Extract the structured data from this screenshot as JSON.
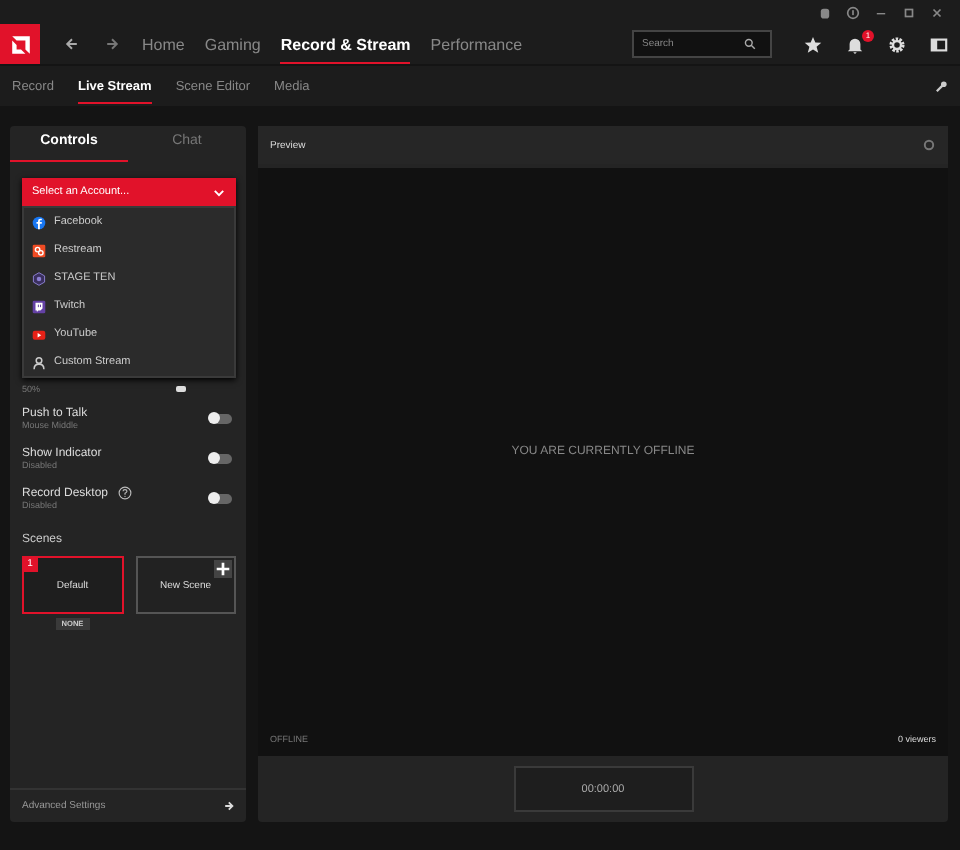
{
  "nav": {
    "items": [
      {
        "label": "Home",
        "selected": false
      },
      {
        "label": "Gaming",
        "selected": false
      },
      {
        "label": "Record & Stream",
        "selected": true
      },
      {
        "label": "Performance",
        "selected": false
      }
    ],
    "search": {
      "placeholder": "Search"
    },
    "notification_count": "1"
  },
  "subnav": {
    "items": [
      {
        "label": "Record",
        "selected": false
      },
      {
        "label": "Live Stream",
        "selected": true
      },
      {
        "label": "Scene Editor",
        "selected": false
      },
      {
        "label": "Media",
        "selected": false
      }
    ]
  },
  "left_panel": {
    "tabs": [
      {
        "label": "Controls",
        "selected": true
      },
      {
        "label": "Chat",
        "selected": false
      }
    ],
    "account_select": {
      "label": "Select an Account...",
      "expanded": true,
      "options": [
        {
          "label": "Facebook",
          "kind": "facebook"
        },
        {
          "label": "Restream",
          "kind": "restream"
        },
        {
          "label": "STAGE TEN",
          "kind": "stageten"
        },
        {
          "label": "Twitch",
          "kind": "twitch"
        },
        {
          "label": "YouTube",
          "kind": "youtube"
        },
        {
          "label": "Custom Stream",
          "kind": "custom"
        }
      ]
    },
    "volume_reading": "50%",
    "toggles": [
      {
        "label": "Push to Talk",
        "sub": "Mouse Middle",
        "on": false,
        "help": false
      },
      {
        "label": "Show Indicator",
        "sub": "Disabled",
        "on": false,
        "help": false
      },
      {
        "label": "Record Desktop",
        "sub": "Disabled",
        "on": false,
        "help": true
      }
    ],
    "scenes_title": "Scenes",
    "scenes": [
      {
        "kind": "scene",
        "name": "Default",
        "number": "1",
        "selected": true,
        "hotkey": "NONE"
      },
      {
        "kind": "add",
        "name": "New Scene",
        "selected": false
      }
    ],
    "advanced": "Advanced Settings"
  },
  "preview": {
    "title": "Preview",
    "message": "YOU ARE CURRENTLY OFFLINE",
    "status": "OFFLINE",
    "viewers": "0 viewers",
    "timer": "00:00:00"
  }
}
